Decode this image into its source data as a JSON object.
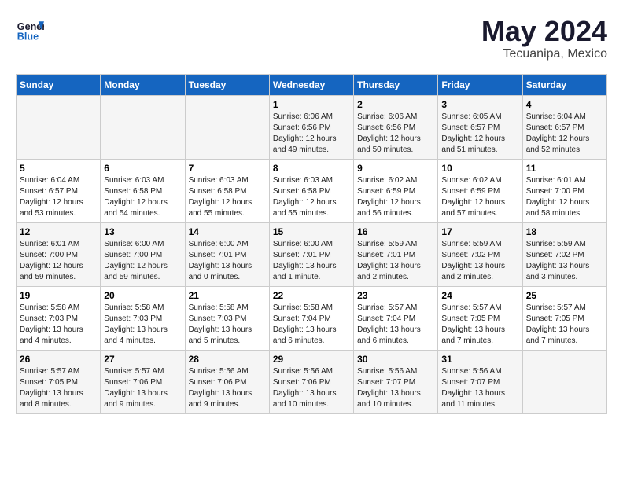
{
  "header": {
    "logo_line1": "General",
    "logo_line2": "Blue",
    "month": "May 2024",
    "location": "Tecuanipa, Mexico"
  },
  "weekdays": [
    "Sunday",
    "Monday",
    "Tuesday",
    "Wednesday",
    "Thursday",
    "Friday",
    "Saturday"
  ],
  "weeks": [
    [
      {
        "day": "",
        "detail": ""
      },
      {
        "day": "",
        "detail": ""
      },
      {
        "day": "",
        "detail": ""
      },
      {
        "day": "1",
        "detail": "Sunrise: 6:06 AM\nSunset: 6:56 PM\nDaylight: 12 hours\nand 49 minutes."
      },
      {
        "day": "2",
        "detail": "Sunrise: 6:06 AM\nSunset: 6:56 PM\nDaylight: 12 hours\nand 50 minutes."
      },
      {
        "day": "3",
        "detail": "Sunrise: 6:05 AM\nSunset: 6:57 PM\nDaylight: 12 hours\nand 51 minutes."
      },
      {
        "day": "4",
        "detail": "Sunrise: 6:04 AM\nSunset: 6:57 PM\nDaylight: 12 hours\nand 52 minutes."
      }
    ],
    [
      {
        "day": "5",
        "detail": "Sunrise: 6:04 AM\nSunset: 6:57 PM\nDaylight: 12 hours\nand 53 minutes."
      },
      {
        "day": "6",
        "detail": "Sunrise: 6:03 AM\nSunset: 6:58 PM\nDaylight: 12 hours\nand 54 minutes."
      },
      {
        "day": "7",
        "detail": "Sunrise: 6:03 AM\nSunset: 6:58 PM\nDaylight: 12 hours\nand 55 minutes."
      },
      {
        "day": "8",
        "detail": "Sunrise: 6:03 AM\nSunset: 6:58 PM\nDaylight: 12 hours\nand 55 minutes."
      },
      {
        "day": "9",
        "detail": "Sunrise: 6:02 AM\nSunset: 6:59 PM\nDaylight: 12 hours\nand 56 minutes."
      },
      {
        "day": "10",
        "detail": "Sunrise: 6:02 AM\nSunset: 6:59 PM\nDaylight: 12 hours\nand 57 minutes."
      },
      {
        "day": "11",
        "detail": "Sunrise: 6:01 AM\nSunset: 7:00 PM\nDaylight: 12 hours\nand 58 minutes."
      }
    ],
    [
      {
        "day": "12",
        "detail": "Sunrise: 6:01 AM\nSunset: 7:00 PM\nDaylight: 12 hours\nand 59 minutes."
      },
      {
        "day": "13",
        "detail": "Sunrise: 6:00 AM\nSunset: 7:00 PM\nDaylight: 12 hours\nand 59 minutes."
      },
      {
        "day": "14",
        "detail": "Sunrise: 6:00 AM\nSunset: 7:01 PM\nDaylight: 13 hours\nand 0 minutes."
      },
      {
        "day": "15",
        "detail": "Sunrise: 6:00 AM\nSunset: 7:01 PM\nDaylight: 13 hours\nand 1 minute."
      },
      {
        "day": "16",
        "detail": "Sunrise: 5:59 AM\nSunset: 7:01 PM\nDaylight: 13 hours\nand 2 minutes."
      },
      {
        "day": "17",
        "detail": "Sunrise: 5:59 AM\nSunset: 7:02 PM\nDaylight: 13 hours\nand 2 minutes."
      },
      {
        "day": "18",
        "detail": "Sunrise: 5:59 AM\nSunset: 7:02 PM\nDaylight: 13 hours\nand 3 minutes."
      }
    ],
    [
      {
        "day": "19",
        "detail": "Sunrise: 5:58 AM\nSunset: 7:03 PM\nDaylight: 13 hours\nand 4 minutes."
      },
      {
        "day": "20",
        "detail": "Sunrise: 5:58 AM\nSunset: 7:03 PM\nDaylight: 13 hours\nand 4 minutes."
      },
      {
        "day": "21",
        "detail": "Sunrise: 5:58 AM\nSunset: 7:03 PM\nDaylight: 13 hours\nand 5 minutes."
      },
      {
        "day": "22",
        "detail": "Sunrise: 5:58 AM\nSunset: 7:04 PM\nDaylight: 13 hours\nand 6 minutes."
      },
      {
        "day": "23",
        "detail": "Sunrise: 5:57 AM\nSunset: 7:04 PM\nDaylight: 13 hours\nand 6 minutes."
      },
      {
        "day": "24",
        "detail": "Sunrise: 5:57 AM\nSunset: 7:05 PM\nDaylight: 13 hours\nand 7 minutes."
      },
      {
        "day": "25",
        "detail": "Sunrise: 5:57 AM\nSunset: 7:05 PM\nDaylight: 13 hours\nand 7 minutes."
      }
    ],
    [
      {
        "day": "26",
        "detail": "Sunrise: 5:57 AM\nSunset: 7:05 PM\nDaylight: 13 hours\nand 8 minutes."
      },
      {
        "day": "27",
        "detail": "Sunrise: 5:57 AM\nSunset: 7:06 PM\nDaylight: 13 hours\nand 9 minutes."
      },
      {
        "day": "28",
        "detail": "Sunrise: 5:56 AM\nSunset: 7:06 PM\nDaylight: 13 hours\nand 9 minutes."
      },
      {
        "day": "29",
        "detail": "Sunrise: 5:56 AM\nSunset: 7:06 PM\nDaylight: 13 hours\nand 10 minutes."
      },
      {
        "day": "30",
        "detail": "Sunrise: 5:56 AM\nSunset: 7:07 PM\nDaylight: 13 hours\nand 10 minutes."
      },
      {
        "day": "31",
        "detail": "Sunrise: 5:56 AM\nSunset: 7:07 PM\nDaylight: 13 hours\nand 11 minutes."
      },
      {
        "day": "",
        "detail": ""
      }
    ]
  ]
}
